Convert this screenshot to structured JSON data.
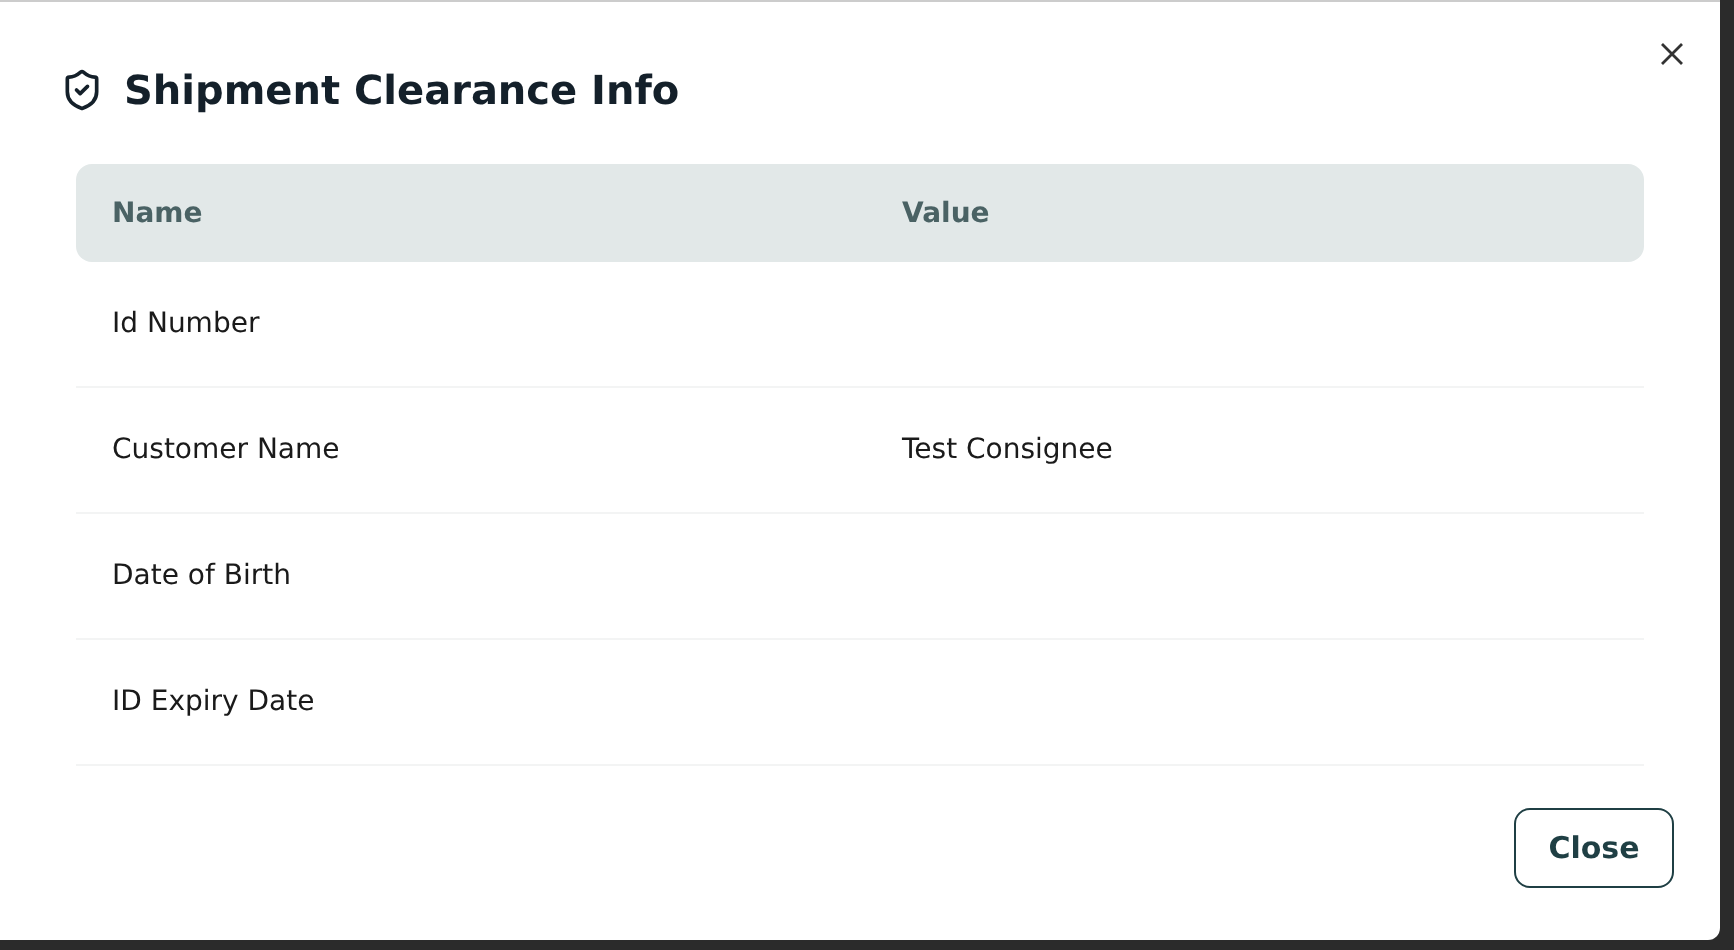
{
  "dialog": {
    "title": "Shipment Clearance Info",
    "close_button": "Close"
  },
  "table": {
    "columns": [
      "Name",
      "Value"
    ],
    "rows": [
      {
        "name": "Id Number"
      },
      {
        "name": "Customer Name",
        "value": "Test Consignee"
      },
      {
        "name": "Date of Birth"
      },
      {
        "name": "ID Expiry Date"
      }
    ]
  }
}
